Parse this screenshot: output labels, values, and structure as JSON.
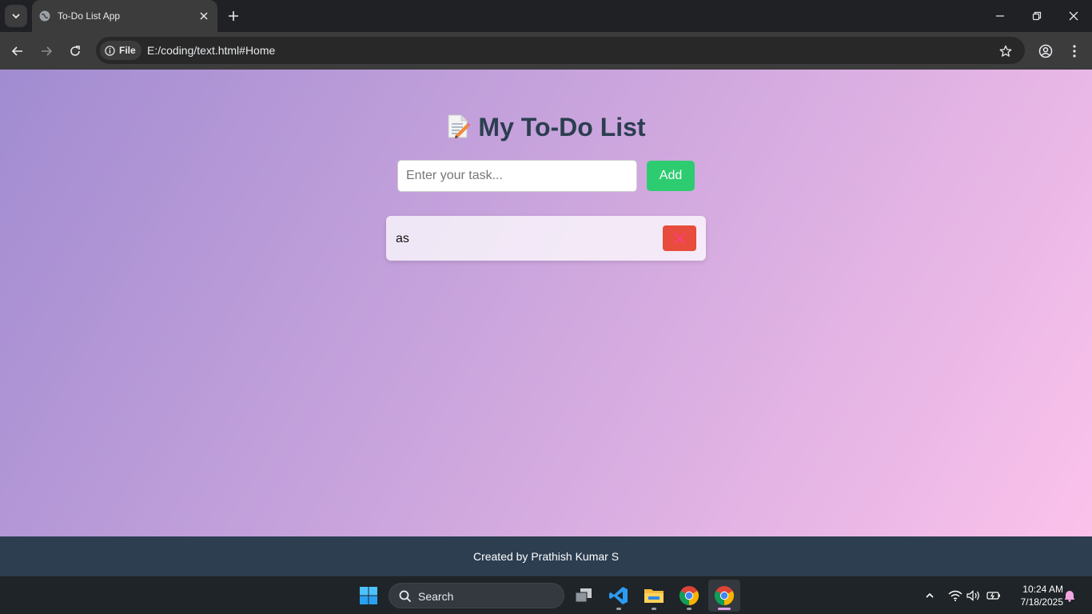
{
  "browser": {
    "tab_title": "To-Do List App",
    "site_chip": "File",
    "url": "E:/coding/text.html#Home"
  },
  "app": {
    "title": "My To-Do List",
    "title_icon": "memo-icon",
    "input_placeholder": "Enter your task...",
    "input_value": "",
    "add_label": "Add",
    "tasks": [
      {
        "text": "as"
      }
    ],
    "footer": "Created by Prathish Kumar S",
    "colors": {
      "gradient_start": "#a18cd1",
      "gradient_end": "#fbc2eb",
      "title": "#2c3e50",
      "add_button": "#2ecc71",
      "delete_button": "#e74c3c",
      "footer": "#2c3e50"
    }
  },
  "taskbar": {
    "search_label": "Search",
    "time": "10:24 AM",
    "date": "7/18/2025",
    "apps": [
      "windows-start-icon",
      "task-view-icon",
      "vscode-icon",
      "file-explorer-icon",
      "chrome-icon",
      "chrome-icon"
    ]
  }
}
